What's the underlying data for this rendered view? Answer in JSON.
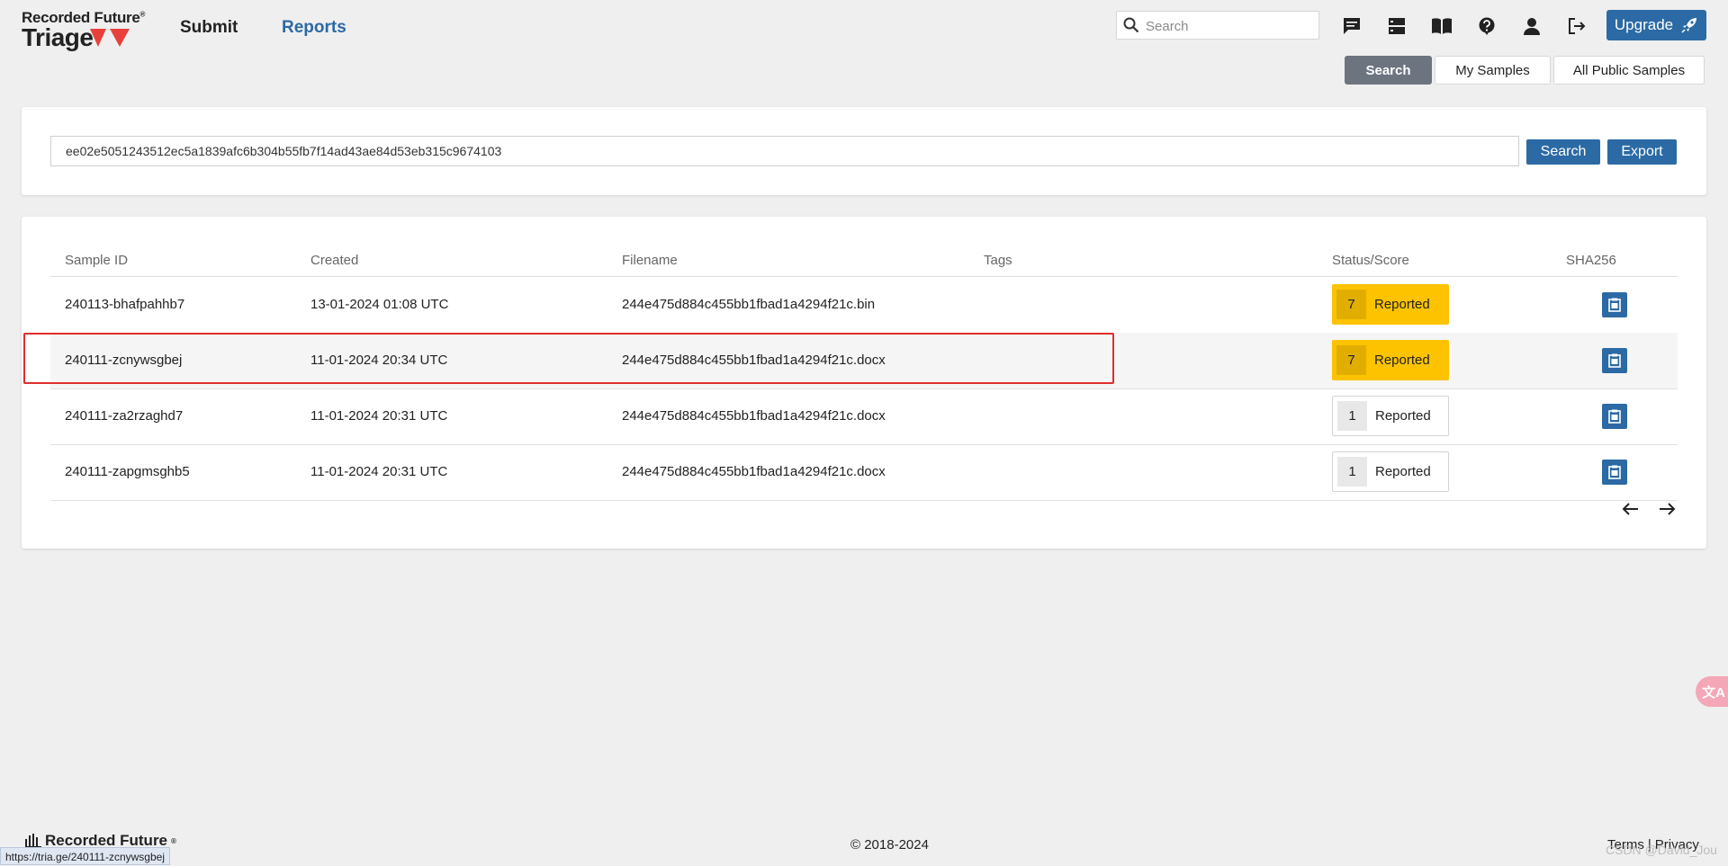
{
  "brand": {
    "company": "Recorded Future",
    "product": "Triage"
  },
  "nav": {
    "submit": "Submit",
    "reports": "Reports"
  },
  "top_search": {
    "placeholder": "Search"
  },
  "upgrade_label": "Upgrade",
  "tabs": [
    {
      "label": "Search",
      "active": true
    },
    {
      "label": "My Samples",
      "active": false
    },
    {
      "label": "All Public Samples",
      "active": false
    }
  ],
  "search_form": {
    "query": "ee02e5051243512ec5a1839afc6b304b55fb7f14ad43ae84d53eb315c9674103",
    "search_button": "Search",
    "export_button": "Export"
  },
  "table": {
    "columns": [
      "Sample ID",
      "Created",
      "Filename",
      "Tags",
      "Status/Score",
      "SHA256"
    ],
    "rows": [
      {
        "sample_id": "240113-bhafpahhb7",
        "created": "13-01-2024 01:08 UTC",
        "filename": "244e475d884c455bb1fbad1a4294f21c.bin",
        "tags": "",
        "score": "7",
        "status": "Reported"
      },
      {
        "sample_id": "240111-zcnywsgbej",
        "created": "11-01-2024 20:34 UTC",
        "filename": "244e475d884c455bb1fbad1a4294f21c.docx",
        "tags": "",
        "score": "7",
        "status": "Reported"
      },
      {
        "sample_id": "240111-za2rzaghd7",
        "created": "11-01-2024 20:31 UTC",
        "filename": "244e475d884c455bb1fbad1a4294f21c.docx",
        "tags": "",
        "score": "1",
        "status": "Reported"
      },
      {
        "sample_id": "240111-zapgmsghb5",
        "created": "11-01-2024 20:31 UTC",
        "filename": "244e475d884c455bb1fbad1a4294f21c.docx",
        "tags": "",
        "score": "1",
        "status": "Reported"
      }
    ]
  },
  "footer": {
    "logo": "Recorded Future",
    "copyright": "© 2018-2024",
    "terms": "Terms",
    "privacy": "Privacy"
  },
  "status_bar_url": "https://tria.ge/240111-zcnywsgbej",
  "watermark": "CSDN @David_Jou",
  "translate_tab": "文A",
  "colors": {
    "brand_blue": "#2b6aa4",
    "score_high": "#fdc300",
    "highlight_box": "#e12d2d",
    "active_tab": "#6c7480"
  },
  "icons": [
    "search-icon",
    "chat-icon",
    "server-icon",
    "book-icon",
    "help-icon",
    "user-icon",
    "logout-icon",
    "rocket-icon",
    "clipboard-icon",
    "arrow-left-icon",
    "arrow-right-icon",
    "translate-icon"
  ]
}
